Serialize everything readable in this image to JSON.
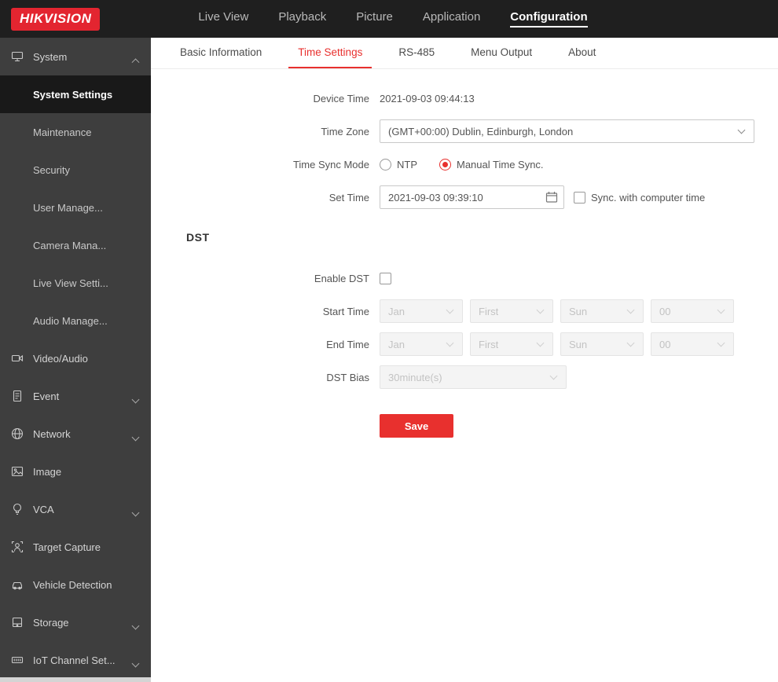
{
  "colors": {
    "accent_red": "#e8302e",
    "logo_red": "#e32530",
    "topbar_bg": "#1f1f1f",
    "sidebar_bg": "#3e3e3e",
    "sidebar_active_bg": "#191919"
  },
  "topbar": {
    "logo_text": "HIKVISION",
    "nav_items": [
      {
        "label": "Live View",
        "active": false
      },
      {
        "label": "Playback",
        "active": false
      },
      {
        "label": "Picture",
        "active": false
      },
      {
        "label": "Application",
        "active": false
      },
      {
        "label": "Configuration",
        "active": true
      }
    ]
  },
  "sidebar": {
    "items": [
      {
        "label": "System",
        "type": "group",
        "icon": "system-icon",
        "chevron": "up",
        "active": false
      },
      {
        "label": "System Settings",
        "type": "child",
        "active": true
      },
      {
        "label": "Maintenance",
        "type": "child",
        "active": false
      },
      {
        "label": "Security",
        "type": "child",
        "active": false
      },
      {
        "label": "User Manage...",
        "type": "child",
        "active": false
      },
      {
        "label": "Camera Mana...",
        "type": "child",
        "active": false
      },
      {
        "label": "Live View Setti...",
        "type": "child",
        "active": false
      },
      {
        "label": "Audio Manage...",
        "type": "child",
        "active": false
      },
      {
        "label": "Video/Audio",
        "type": "group",
        "icon": "video-audio-icon",
        "chevron": null,
        "active": false
      },
      {
        "label": "Event",
        "type": "group",
        "icon": "event-icon",
        "chevron": "down",
        "active": false
      },
      {
        "label": "Network",
        "type": "group",
        "icon": "network-icon",
        "chevron": "down",
        "active": false
      },
      {
        "label": "Image",
        "type": "group",
        "icon": "image-icon",
        "chevron": null,
        "active": false
      },
      {
        "label": "VCA",
        "type": "group",
        "icon": "vca-icon",
        "chevron": "down",
        "active": false
      },
      {
        "label": "Target Capture",
        "type": "group",
        "icon": "target-capture-icon",
        "chevron": null,
        "active": false
      },
      {
        "label": "Vehicle Detection",
        "type": "group",
        "icon": "vehicle-detection-icon",
        "chevron": null,
        "active": false
      },
      {
        "label": "Storage",
        "type": "group",
        "icon": "storage-icon",
        "chevron": "down",
        "active": false
      },
      {
        "label": "IoT Channel Set...",
        "type": "group",
        "icon": "iot-channel-icon",
        "chevron": "down",
        "active": false
      }
    ]
  },
  "tabs": [
    {
      "label": "Basic Information",
      "active": false
    },
    {
      "label": "Time Settings",
      "active": true
    },
    {
      "label": "RS-485",
      "active": false
    },
    {
      "label": "Menu Output",
      "active": false
    },
    {
      "label": "About",
      "active": false
    }
  ],
  "form": {
    "device_time": {
      "label": "Device Time",
      "value": "2021-09-03 09:44:13"
    },
    "time_zone": {
      "label": "Time Zone",
      "value": "(GMT+00:00) Dublin, Edinburgh, London"
    },
    "time_sync_mode": {
      "label": "Time Sync Mode",
      "options": [
        {
          "label": "NTP",
          "selected": false
        },
        {
          "label": "Manual Time Sync.",
          "selected": true
        }
      ]
    },
    "set_time": {
      "label": "Set Time",
      "value": "2021-09-03 09:39:10",
      "sync_checkbox_label": "Sync. with computer time",
      "sync_checked": false
    },
    "dst_section": {
      "title": "DST"
    },
    "enable_dst": {
      "label": "Enable DST",
      "checked": false
    },
    "start_time": {
      "label": "Start Time",
      "values": [
        "Jan",
        "First",
        "Sun",
        "00"
      ]
    },
    "end_time": {
      "label": "End Time",
      "values": [
        "Jan",
        "First",
        "Sun",
        "00"
      ]
    },
    "dst_bias": {
      "label": "DST Bias",
      "value": "30minute(s)"
    },
    "save_button": "Save"
  }
}
